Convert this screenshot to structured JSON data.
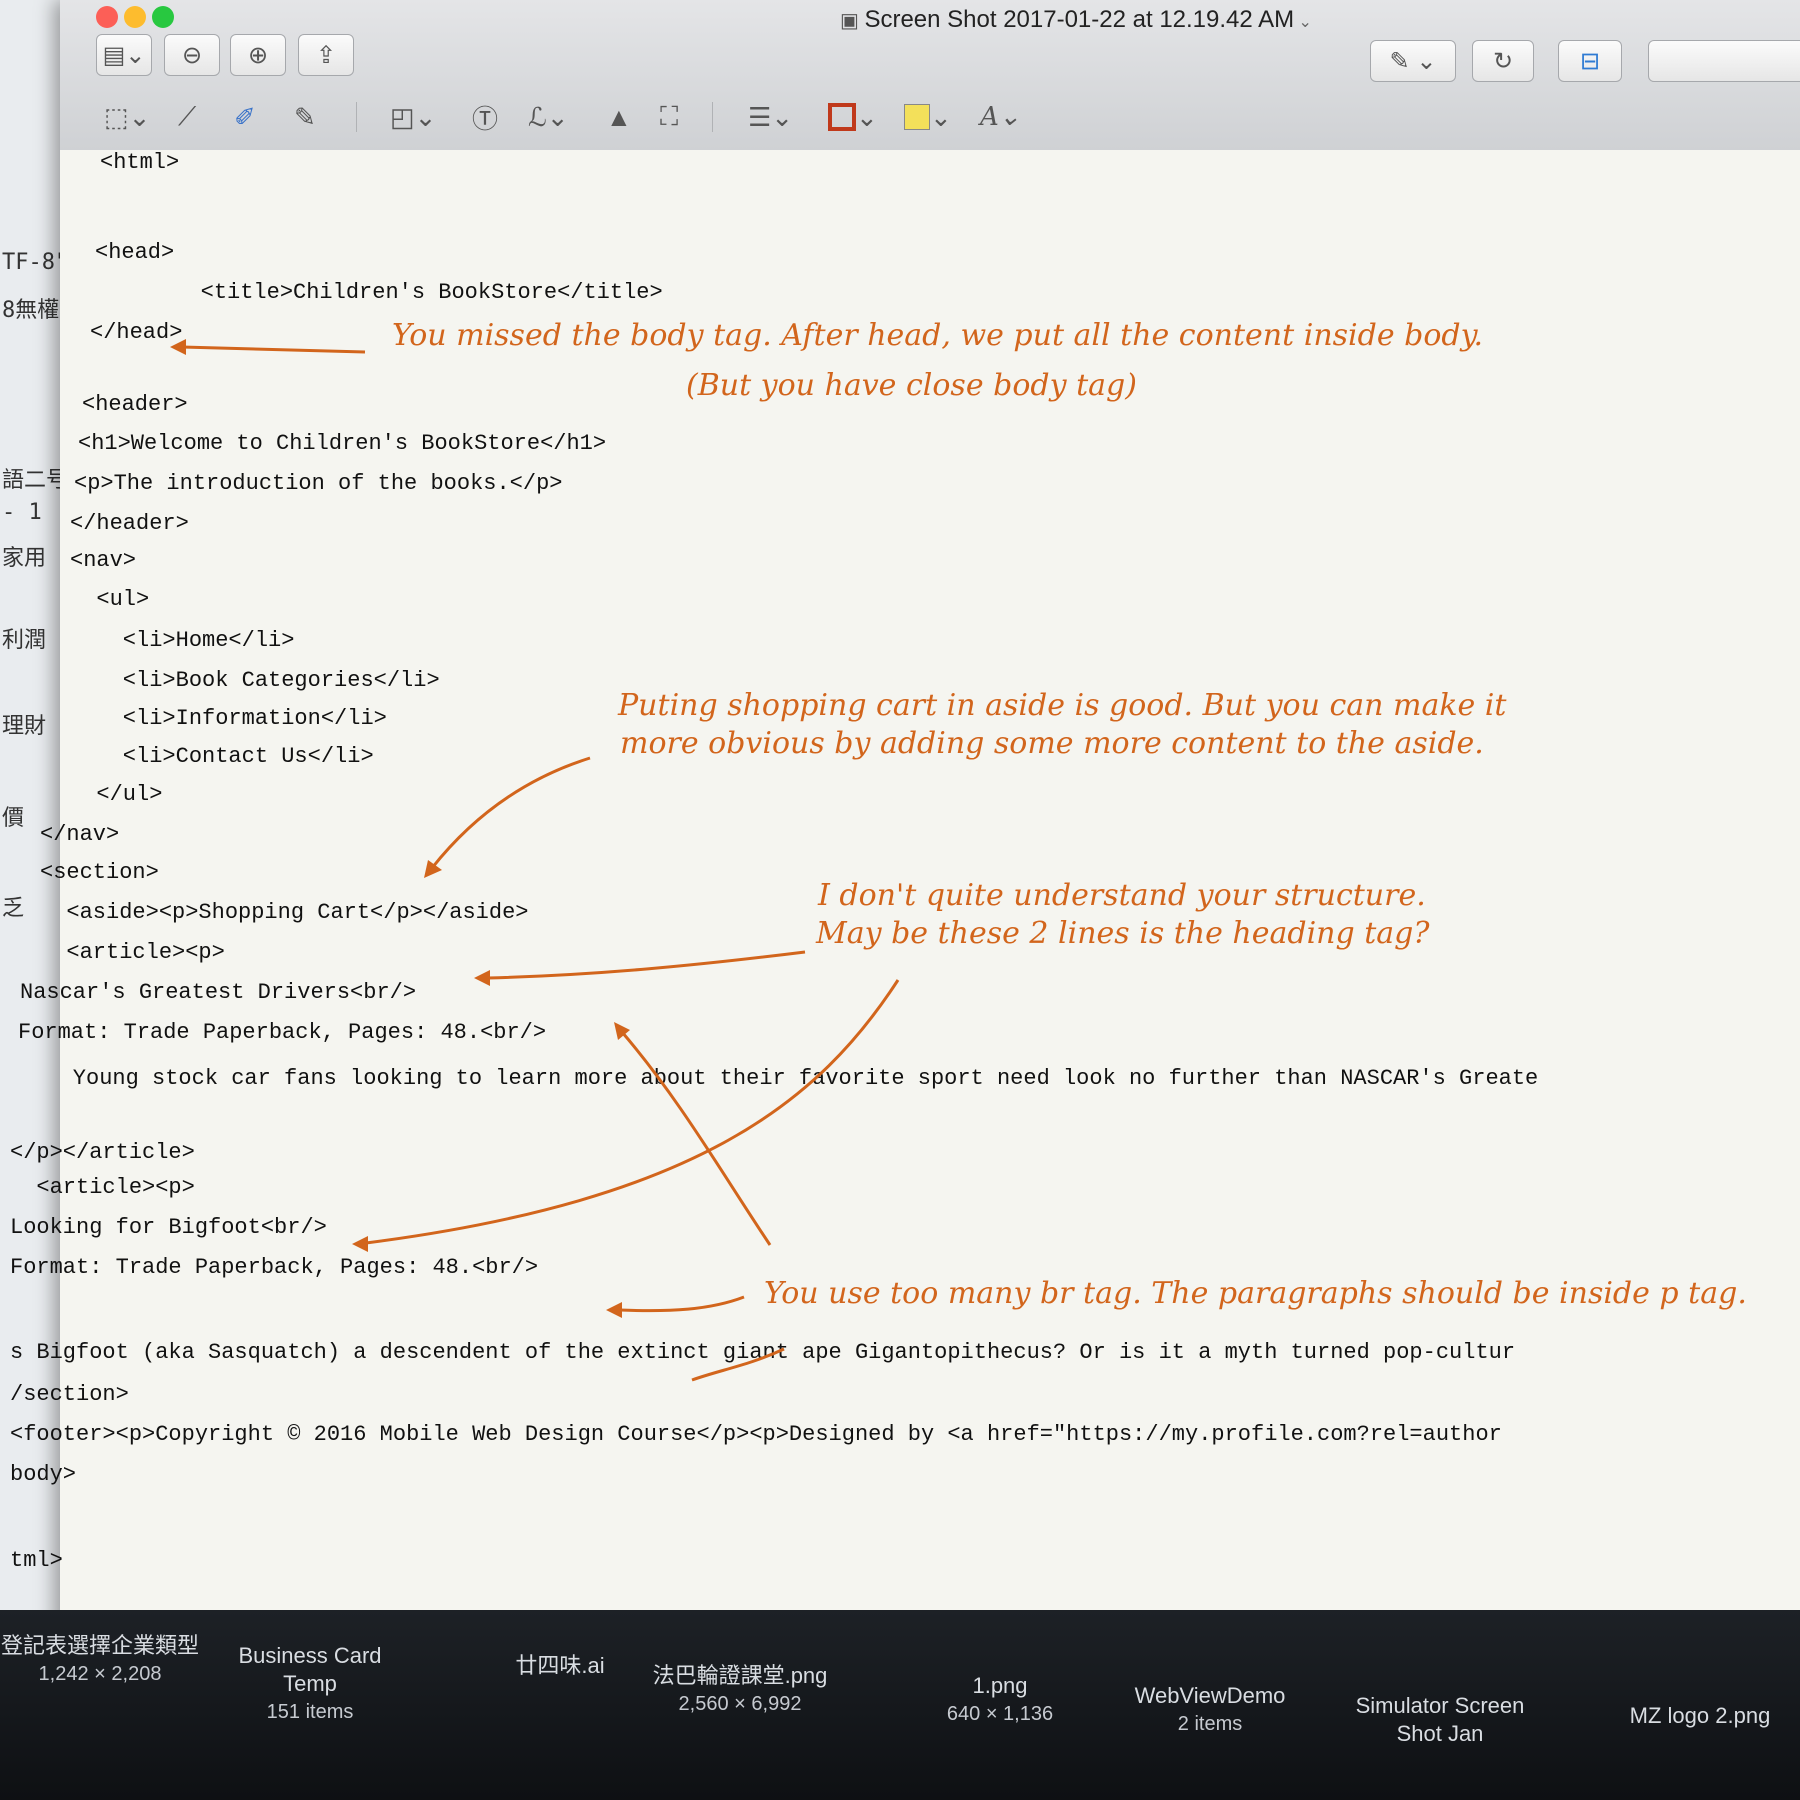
{
  "window": {
    "title": "Screen Shot 2017-01-22 at 12.19.42 AM"
  },
  "background_window": {
    "lines": [
      "TF-8\"",
      "8無權",
      "語二号",
      "- 1",
      "家用",
      "利潤",
      "理財",
      "價",
      "乏"
    ]
  },
  "toolbar": {
    "sidebar": "sidebar-toggle",
    "zoom_out": "zoom-out",
    "zoom_in": "zoom-in",
    "share": "share",
    "pen": "pen",
    "rotate": "rotate",
    "toolbox": "toolbox"
  },
  "markup": [
    "rect-select",
    "magic-wand",
    "sketch",
    "draw",
    "shapes",
    "text",
    "sign",
    "adjust-color",
    "crop",
    "line-style",
    "border-color",
    "fill-color",
    "text-style"
  ],
  "colors": {
    "annotation": "#d2651c",
    "border_swatch": "#c0391b",
    "fill_swatch": "#f3e05a"
  },
  "code_lines": [
    "<html>",
    "<head>",
    "        <title>Children's BookStore</title>",
    "</head>",
    "<header>",
    "<h1>Welcome to Children's BookStore</h1>",
    "<p>The introduction of the books.</p>",
    "</header>",
    "<nav>",
    "  <ul>",
    "    <li>Home</li>",
    "    <li>Book Categories</li>",
    "    <li>Information</li>",
    "    <li>Contact Us</li>",
    "  </ul>",
    "</nav>",
    "<section>",
    "  <aside><p>Shopping Cart</p></aside>",
    "  <article><p>",
    "Nascar's Greatest Drivers<br/>",
    "Format: Trade Paperback, Pages: 48.<br/>",
    "    Young stock car fans looking to learn more about their favorite sport need look no further than NASCAR's Greate",
    "</p></article>",
    "  <article><p>",
    "Looking for Bigfoot<br/>",
    "Format: Trade Paperback, Pages: 48.<br/>",
    "s Bigfoot (aka Sasquatch) a descendent of the extinct giant ape Gigantopithecus? Or is it a myth turned pop-cultur",
    "/section>",
    "<footer><p>Copyright © 2016 Mobile Web Design Course</p><p>Designed by <a href=\"https://my.profile.com?rel=author",
    "body>",
    "tml>"
  ],
  "annotations": [
    "You missed the body tag. After head, we put all the content inside body.",
    "(But you have close body tag)",
    "Puting shopping cart in aside is good. But you can make it",
    "more obvious by adding some more content to the aside.",
    "I don't quite understand your structure.",
    "May be these 2 lines is the heading tag?",
    "You use too many br tag. The paragraphs should be inside p tag."
  ],
  "dock_files": [
    {
      "name": "登記表選擇企業類型",
      "info": "1,242 × 2,208"
    },
    {
      "name": "Business Card Temp",
      "info": "151 items"
    },
    {
      "name": "廿四味.ai",
      "info": ""
    },
    {
      "name": "法巴輪證課堂.png",
      "info": "2,560 × 6,992"
    },
    {
      "name": "1.png",
      "info": "640 × 1,136"
    },
    {
      "name": "WebViewDemo",
      "info": "2 items"
    },
    {
      "name": "Simulator Screen Shot Jan",
      "info": ""
    },
    {
      "name": "MZ logo 2.png",
      "info": ""
    }
  ]
}
